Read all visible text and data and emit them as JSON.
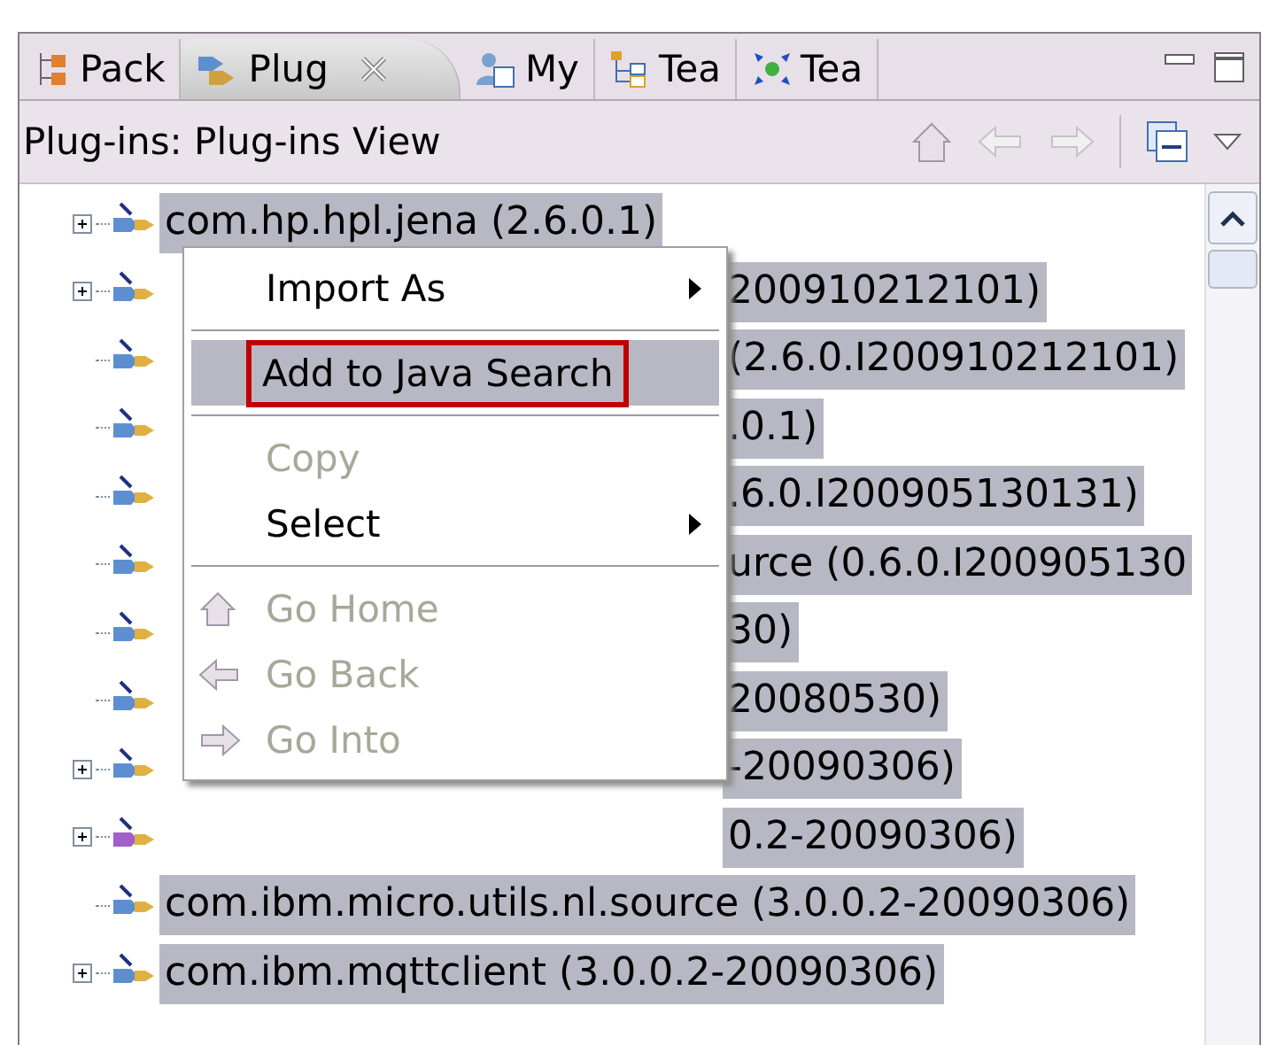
{
  "tabs": [
    {
      "label": "Pack",
      "selected": false,
      "closable": false
    },
    {
      "label": "Plug",
      "selected": true,
      "closable": true
    },
    {
      "label": "My",
      "selected": false,
      "closable": false
    },
    {
      "label": "Tea",
      "selected": false,
      "closable": false
    },
    {
      "label": "Tea",
      "selected": false,
      "closable": false
    }
  ],
  "view": {
    "title": "Plug-ins: Plug-ins View"
  },
  "tree": {
    "rows": [
      {
        "text": "com.hp.hpl.jena (2.6.0.1)",
        "kind": "full",
        "expandable": true,
        "selected": true,
        "color": "#5d8fd0"
      },
      {
        "text": "200910212101)",
        "kind": "partial",
        "expandable": true,
        "selected": true,
        "color": "#5d8fd0"
      },
      {
        "text": "(2.6.0.I200910212101)",
        "kind": "partial",
        "expandable": false,
        "selected": true,
        "color": "#5d8fd0"
      },
      {
        "text": ".0.1)",
        "kind": "partial",
        "expandable": false,
        "selected": true,
        "color": "#5d8fd0"
      },
      {
        "text": ".6.0.I200905130131)",
        "kind": "partial",
        "expandable": false,
        "selected": true,
        "color": "#5d8fd0"
      },
      {
        "text": "urce (0.6.0.I200905130",
        "kind": "partial",
        "expandable": false,
        "selected": true,
        "color": "#5d8fd0"
      },
      {
        "text": "30)",
        "kind": "partial",
        "expandable": false,
        "selected": true,
        "color": "#5d8fd0"
      },
      {
        "text": "20080530)",
        "kind": "partial",
        "expandable": false,
        "selected": true,
        "color": "#5d8fd0"
      },
      {
        "text": "-20090306)",
        "kind": "partial",
        "expandable": true,
        "selected": true,
        "color": "#5d8fd0"
      },
      {
        "text": "0.2-20090306)",
        "kind": "partial",
        "expandable": true,
        "selected": true,
        "color": "#a060c8"
      },
      {
        "text": "com.ibm.micro.utils.nl.source (3.0.0.2-20090306)",
        "kind": "full",
        "expandable": false,
        "selected": true,
        "color": "#5d8fd0"
      },
      {
        "text": "com.ibm.mqttclient (3.0.0.2-20090306)",
        "kind": "full",
        "expandable": true,
        "selected": true,
        "color": "#5d8fd0"
      }
    ]
  },
  "context_menu": {
    "items": [
      {
        "kind": "item",
        "label": "Import As",
        "submenu": true,
        "disabled": false,
        "selected": false
      },
      {
        "kind": "separator"
      },
      {
        "kind": "item",
        "label": "Add to Java Search",
        "submenu": false,
        "disabled": false,
        "selected": true
      },
      {
        "kind": "separator"
      },
      {
        "kind": "item",
        "label": "Copy",
        "submenu": false,
        "disabled": true,
        "selected": false
      },
      {
        "kind": "item",
        "label": "Select",
        "submenu": true,
        "disabled": false,
        "selected": false
      },
      {
        "kind": "separator"
      },
      {
        "kind": "nav",
        "label": "Go Home",
        "submenu": false,
        "disabled": true,
        "selected": false
      },
      {
        "kind": "nav",
        "label": "Go Back",
        "submenu": false,
        "disabled": true,
        "selected": false
      },
      {
        "kind": "nav",
        "label": "Go Into",
        "submenu": false,
        "disabled": true,
        "selected": false
      }
    ]
  }
}
